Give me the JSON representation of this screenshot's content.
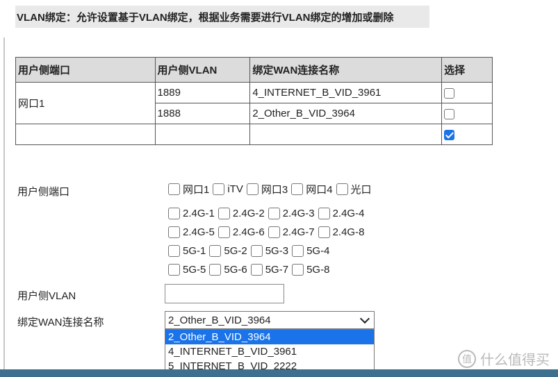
{
  "header": {
    "title": "VLAN绑定：允许设置基于VLAN绑定，根据业务需要进行VLAN绑定的增加或删除"
  },
  "table": {
    "columns": [
      "用户侧端口",
      "用户侧VLAN",
      "绑定WAN连接名称",
      "选择"
    ],
    "group_port": "网口1",
    "rows": [
      {
        "vlan": "1889",
        "wan": "4_INTERNET_B_VID_3961",
        "checked": false
      },
      {
        "vlan": "1888",
        "wan": "2_Other_B_VID_3964",
        "checked": false
      },
      {
        "vlan": "",
        "wan": "",
        "checked": true
      }
    ]
  },
  "form": {
    "port_label": "用户侧端口",
    "port_options": [
      [
        "网口1",
        "iTV",
        "网口3",
        "网口4",
        "光口"
      ],
      [
        "2.4G-1",
        "2.4G-2",
        "2.4G-3",
        "2.4G-4"
      ],
      [
        "2.4G-5",
        "2.4G-6",
        "2.4G-7",
        "2.4G-8"
      ],
      [
        "5G-1",
        "5G-2",
        "5G-3",
        "5G-4"
      ],
      [
        "5G-5",
        "5G-6",
        "5G-7",
        "5G-8"
      ]
    ],
    "vlan_label": "用户侧VLAN",
    "vlan_value": "",
    "wan_label": "绑定WAN连接名称",
    "wan_selected": "2_Other_B_VID_3964",
    "wan_options": [
      "2_Other_B_VID_3964",
      "4_INTERNET_B_VID_3961",
      "5_INTERNET_B_VID_2222"
    ]
  },
  "watermark": {
    "badge": "值",
    "text": "什么值得买"
  },
  "colors": {
    "accent": "#1a73e8",
    "bottom_bar": "#3f6f8f",
    "header_bg": "#e9e9e9"
  }
}
